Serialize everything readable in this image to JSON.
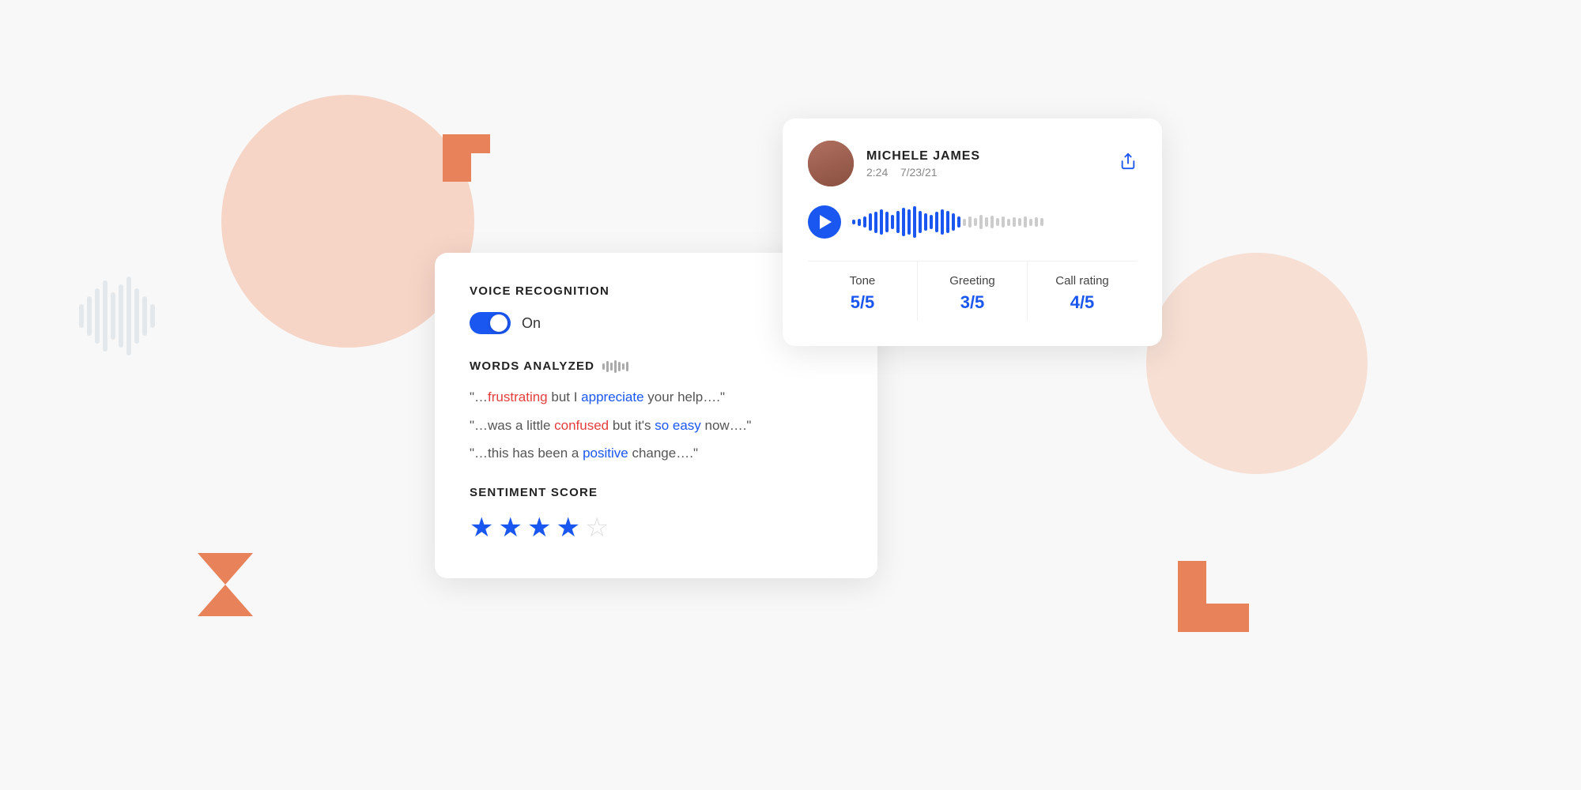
{
  "background": {
    "color": "#f8f8f8"
  },
  "voice_card": {
    "title": "VOICE RECOGNITION",
    "toggle": {
      "state": "on",
      "label": "On"
    },
    "words_analyzed": {
      "title": "WORDS ANALYZED"
    },
    "quotes": [
      {
        "prefix": "“…",
        "word1": "frustrating",
        "word1_color": "red",
        "middle": " but I ",
        "word2": "appreciate",
        "word2_color": "blue",
        "suffix": " your help….”"
      },
      {
        "prefix": "“…was a little ",
        "word1": "confused",
        "word1_color": "red",
        "middle": " but it’s ",
        "word2": "so easy",
        "word2_color": "blue",
        "suffix": " now….”"
      },
      {
        "prefix": "“…this has been a ",
        "word1": "positive",
        "word1_color": "blue",
        "suffix": " change….”"
      }
    ],
    "sentiment": {
      "title": "SENTIMENT SCORE",
      "stars_filled": 4,
      "stars_empty": 1
    }
  },
  "call_card": {
    "user": {
      "name": "MICHELE JAMES",
      "duration": "2:24",
      "date": "7/23/21"
    },
    "metrics": [
      {
        "label": "Tone",
        "value": "5/5"
      },
      {
        "label": "Greeting",
        "value": "3/5"
      },
      {
        "label": "Call rating",
        "value": "4/5"
      }
    ],
    "share_icon": "↗"
  },
  "waveform": {
    "active_bars": [
      3,
      5,
      8,
      12,
      15,
      18,
      14,
      10,
      16,
      20,
      18,
      22,
      16,
      12,
      10,
      14,
      18,
      16,
      12,
      8
    ],
    "inactive_bars": [
      5,
      8,
      6,
      10,
      7,
      9,
      6,
      8,
      5,
      7,
      6,
      8,
      5,
      7,
      6
    ]
  }
}
